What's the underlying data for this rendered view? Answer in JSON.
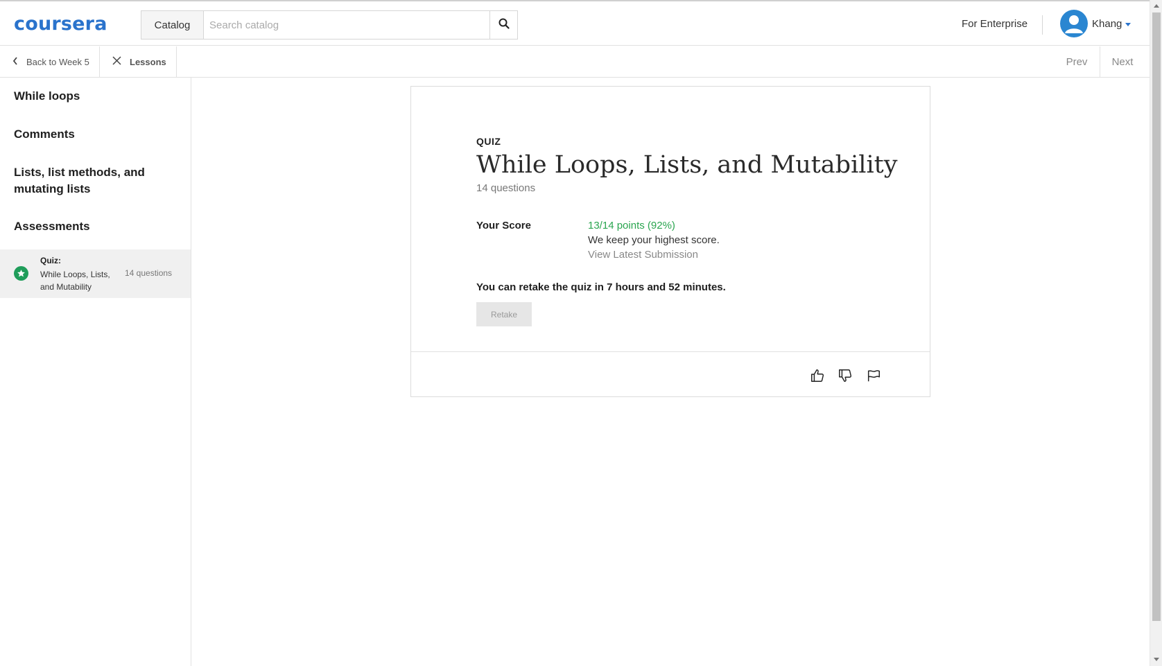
{
  "header": {
    "logo": "coursera",
    "catalog_label": "Catalog",
    "search_placeholder": "Search catalog",
    "search_value": "",
    "enterprise_label": "For Enterprise",
    "username": "Khang"
  },
  "subheader": {
    "back_label": "Back to Week 5",
    "lessons_label": "Lessons",
    "prev_label": "Prev",
    "next_label": "Next"
  },
  "sidebar": {
    "headings": [
      "While loops",
      "Comments",
      "Lists, list methods, and mutating lists",
      "Assessments"
    ],
    "active_item": {
      "type_label": "Quiz:",
      "title": "While Loops, Lists, and Mutability",
      "count": "14 questions"
    }
  },
  "quiz": {
    "label": "QUIZ",
    "title": "While Loops, Lists, and Mutability",
    "question_count": "14 questions",
    "score_label": "Your Score",
    "score_value": "13/14 points (92%)",
    "score_note": "We keep your highest score.",
    "latest_submission_label": "View Latest Submission",
    "retake_note": "You can retake the quiz in 7 hours and 52 minutes.",
    "retake_label": "Retake"
  },
  "colors": {
    "brand": "#2a73cc",
    "score": "#2aa54f",
    "completed": "#1f9d5a"
  },
  "icons": {
    "search": "search-icon",
    "back": "chevron-left-icon",
    "close": "close-icon",
    "completed": "star-icon",
    "like": "thumbs-up-icon",
    "dislike": "thumbs-down-icon",
    "flag": "flag-icon"
  }
}
